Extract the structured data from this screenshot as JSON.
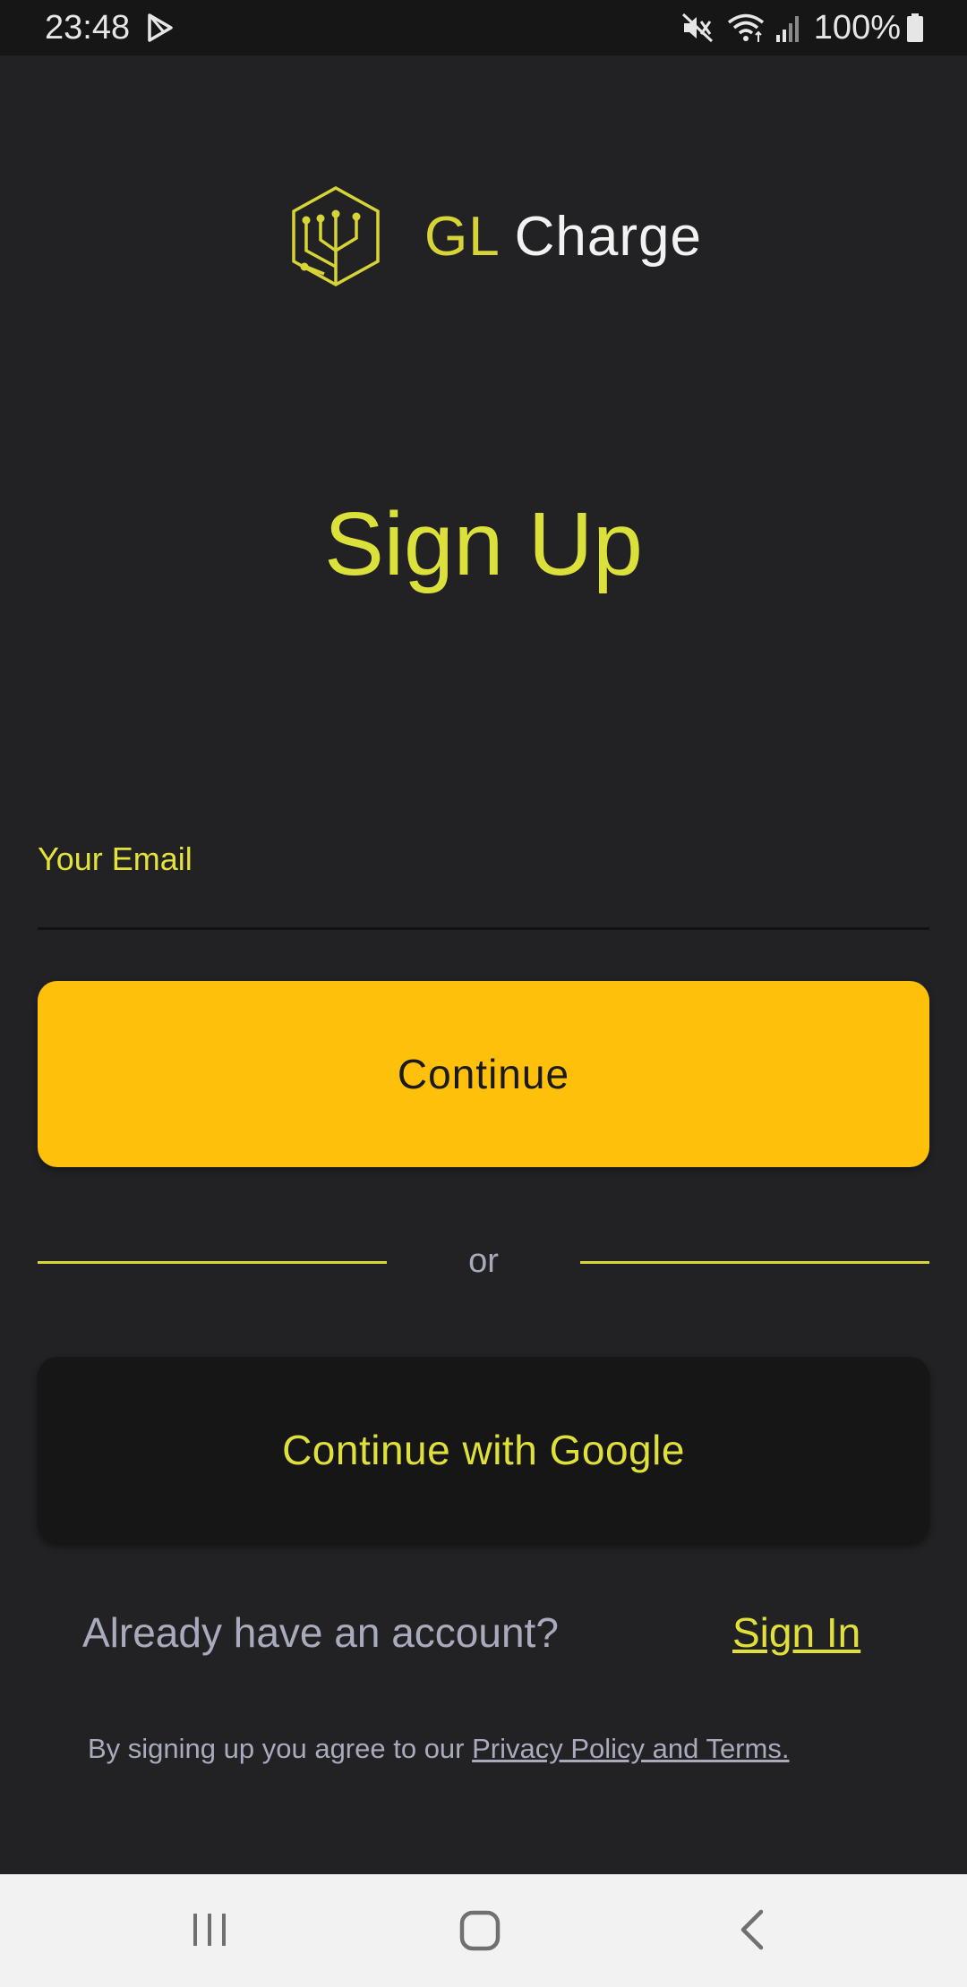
{
  "status_bar": {
    "time": "23:48",
    "battery": "100%",
    "icons": [
      "play-store-icon",
      "mute-icon",
      "wifi-icon",
      "signal-icon",
      "battery-icon"
    ]
  },
  "logo": {
    "mark_icon": "circuit-hexagon-icon",
    "text_gl": "GL",
    "text_charge": "Charge"
  },
  "title": "Sign Up",
  "email_field": {
    "label": "Your Email",
    "value": ""
  },
  "continue_button": {
    "label": "Continue"
  },
  "divider": {
    "text": "or"
  },
  "google_button": {
    "label": "Continue with Google"
  },
  "signin": {
    "prompt": "Already have an account?",
    "link": "Sign In"
  },
  "terms": {
    "prefix": "By signing up you agree to our ",
    "link": "Privacy Policy and Terms."
  },
  "nav_bar": {
    "icons": [
      "recents-icon",
      "home-icon",
      "back-icon"
    ]
  },
  "colors": {
    "background": "#222224",
    "accent_yellow": "#dbe03a",
    "button_amber": "#fec00b",
    "google_button_bg": "#161617",
    "muted_text": "#a9abbd"
  }
}
